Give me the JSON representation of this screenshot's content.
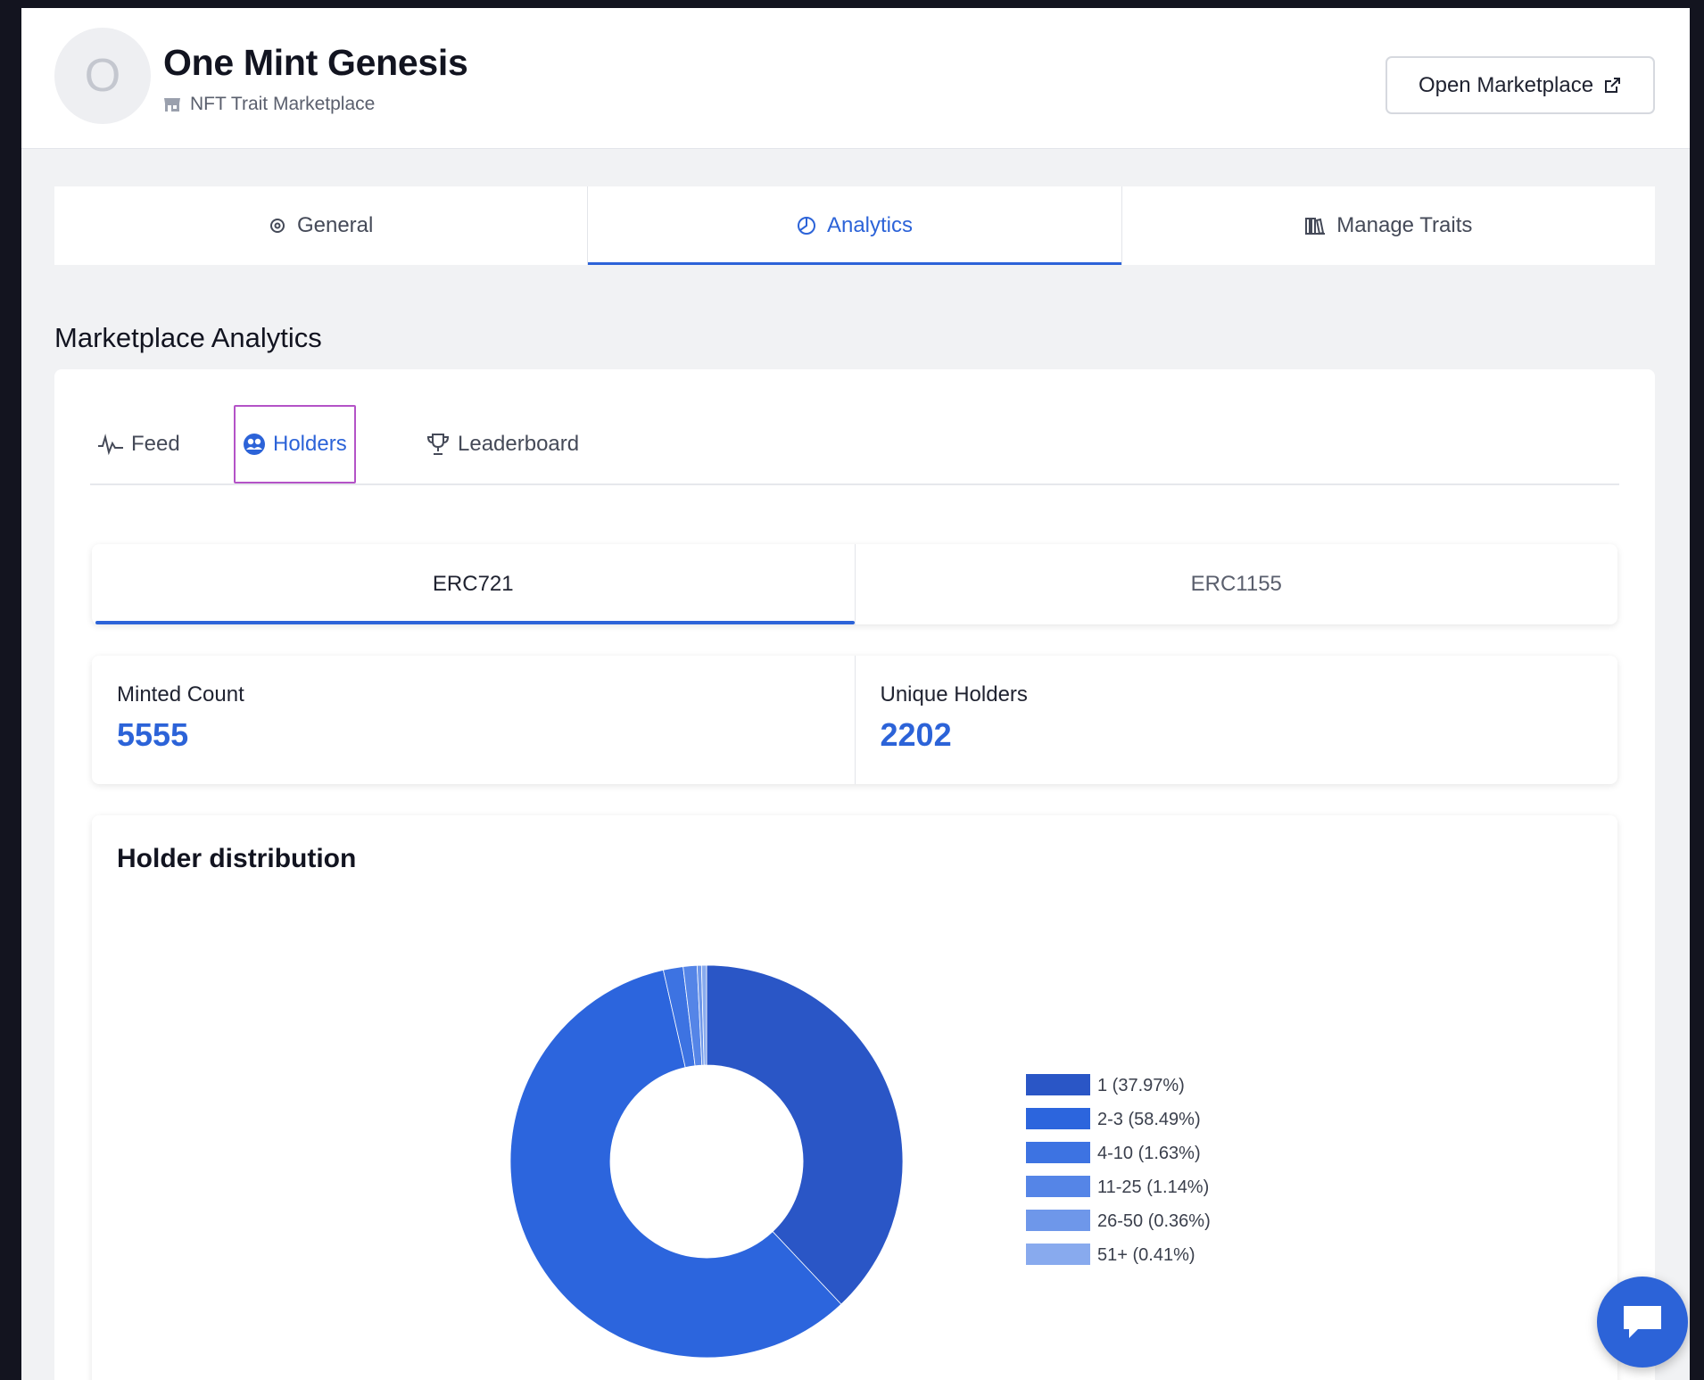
{
  "header": {
    "avatar_letter": "O",
    "collection_name": "One Mint Genesis",
    "subtitle": "NFT Trait Marketplace",
    "open_button": "Open Marketplace"
  },
  "top_tabs": [
    {
      "label": "General",
      "icon": "gear-icon",
      "active": false
    },
    {
      "label": "Analytics",
      "icon": "pie-chart-icon",
      "active": true
    },
    {
      "label": "Manage Traits",
      "icon": "books-icon",
      "active": false
    }
  ],
  "section_title": "Marketplace Analytics",
  "sub_tabs": [
    {
      "label": "Feed",
      "icon": "activity-icon"
    },
    {
      "label": "Holders",
      "icon": "users-icon"
    },
    {
      "label": "Leaderboard",
      "icon": "trophy-icon"
    }
  ],
  "erc_tabs": [
    "ERC721",
    "ERC1155"
  ],
  "stats": {
    "minted_label": "Minted Count",
    "minted_value": "5555",
    "holders_label": "Unique Holders",
    "holders_value": "2202"
  },
  "chart_data": {
    "type": "pie",
    "title": "Holder distribution",
    "labels": [
      "1 (37.97%)",
      "2-3 (58.49%)",
      "4-10 (1.63%)",
      "11-25 (1.14%)",
      "26-50 (0.36%)",
      "51+ (0.41%)"
    ],
    "values": [
      37.97,
      58.49,
      1.63,
      1.14,
      0.36,
      0.41
    ],
    "colors": [
      "#2a56c6",
      "#2c65dd",
      "#3d73e2",
      "#5585e7",
      "#6e97ea",
      "#88aaee"
    ],
    "legend": "right"
  },
  "colors": {
    "accent": "#2c63d8",
    "highlight_border": "#b453c7"
  }
}
